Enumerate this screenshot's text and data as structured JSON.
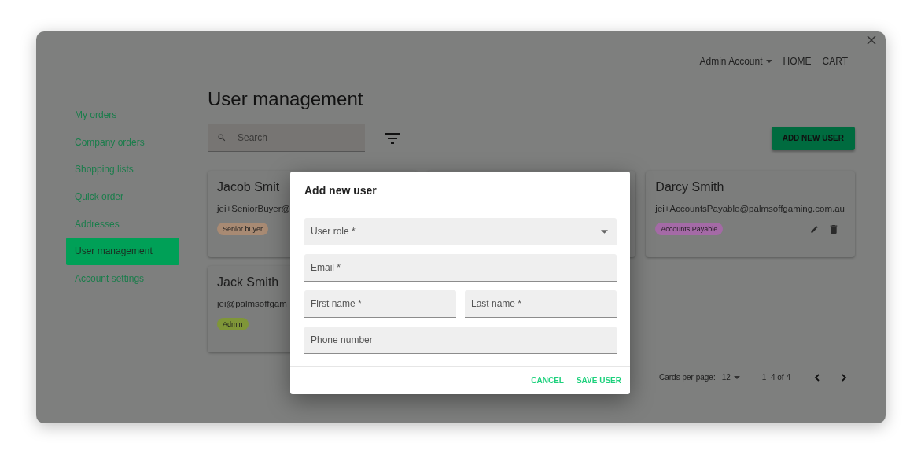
{
  "topbar": {
    "account": "Admin Account",
    "links": [
      "HOME",
      "CART"
    ]
  },
  "sidebar": {
    "items": [
      {
        "label": "My orders",
        "selected": false
      },
      {
        "label": "Company orders",
        "selected": false
      },
      {
        "label": "Shopping lists",
        "selected": false
      },
      {
        "label": "Quick order",
        "selected": false
      },
      {
        "label": "Addresses",
        "selected": false
      },
      {
        "label": "User management",
        "selected": true
      },
      {
        "label": "Account settings",
        "selected": false
      }
    ]
  },
  "title": "User management",
  "search": {
    "placeholder": "Search"
  },
  "add_button": "ADD NEW USER",
  "cards": [
    {
      "kind": "user",
      "name": "Jacob Smit",
      "email": "jei+SeniorBuyer@",
      "role": "Senior buyer",
      "color": "#a88a73",
      "actions": false
    },
    {
      "kind": "hidden"
    },
    {
      "kind": "user",
      "name": "Darcy Smith",
      "email": "jei+AccountsPayable@palmsoffgaming.com.au",
      "role": "Accounts Payable",
      "color": "#a46aa6",
      "actions": true
    },
    {
      "kind": "user",
      "name": "Jack Smith",
      "email": "jei@palmsoffgam",
      "role": "Admin",
      "color": "#7f9638",
      "actions": false
    }
  ],
  "pagination": {
    "label": "Cards per page:",
    "per_page": "12",
    "range": "1–4 of 4"
  },
  "dialog": {
    "title": "Add new user",
    "fields": [
      {
        "placeholder": "User role *",
        "kind": "select"
      },
      {
        "placeholder": "Email *",
        "kind": "text"
      },
      {
        "placeholder": "First name *",
        "kind": "half"
      },
      {
        "placeholder": "Last name *",
        "kind": "half"
      },
      {
        "placeholder": "Phone number",
        "kind": "text"
      }
    ],
    "buttons": [
      "CANCEL",
      "SAVE USER"
    ]
  }
}
